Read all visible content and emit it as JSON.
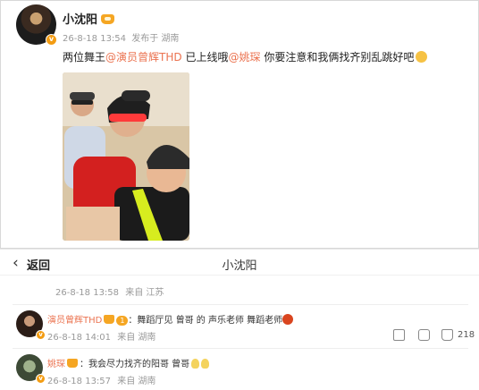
{
  "post": {
    "author": "小沈阳",
    "date": "26-8-18 13:54",
    "source": "发布于 湖南",
    "text_prefix": "两位舞王",
    "mention1": "@演员曾辉THD",
    "text_mid": "已上线哦",
    "mention2": "@姚琛",
    "text_suffix": "你要注意和我俩找齐别乱跳好吧"
  },
  "nav": {
    "back_label": "返回",
    "title": "小沈阳"
  },
  "thread_meta": {
    "date": "26-8-18 13:58",
    "source": "来自 江苏"
  },
  "comments": [
    {
      "name": "演员曾辉THD",
      "level": "1",
      "text": "：舞蹈厅见  曾哥 的 声乐老师 舞蹈老师",
      "date": "26-8-18 14:01",
      "source": "来自 湖南",
      "likes": "218"
    },
    {
      "name": "姚琛",
      "text": "：我会尽力找齐的阳哥  曾哥",
      "date": "26-8-18 13:57",
      "source": "来自 湖南"
    }
  ],
  "colors": {
    "mention": "#eb7350",
    "badge": "#f5a623",
    "meta": "#999999"
  }
}
